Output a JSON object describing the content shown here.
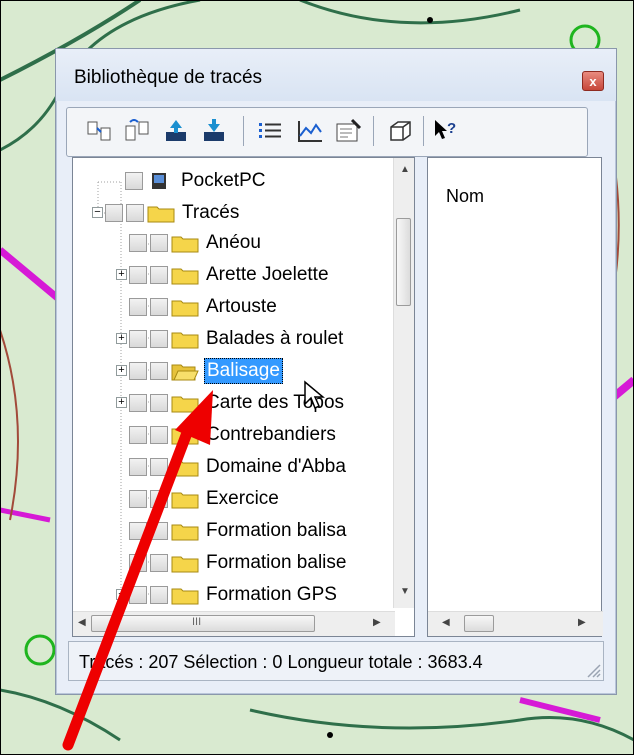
{
  "window": {
    "title": "Bibliothèque de tracés",
    "close_glyph": "x"
  },
  "toolbar": {
    "buttons": [
      {
        "icon": "move-items-icon"
      },
      {
        "icon": "transfer-items-icon"
      },
      {
        "icon": "gps-upload-icon"
      },
      {
        "icon": "gps-download-icon"
      },
      {
        "icon": "list-view-icon"
      },
      {
        "icon": "profile-chart-icon"
      },
      {
        "icon": "properties-icon"
      },
      {
        "icon": "3d-view-icon"
      },
      {
        "icon": "help-cursor-icon"
      }
    ]
  },
  "tree": {
    "nodes": [
      {
        "label": "PocketPC",
        "type": "device"
      },
      {
        "label": "Tracés",
        "type": "folder",
        "expanded": true
      },
      {
        "label": "Anéou",
        "type": "folder"
      },
      {
        "label": "Arette Joelette",
        "type": "folder",
        "expandable": true
      },
      {
        "label": "Artouste",
        "type": "folder"
      },
      {
        "label": "Balades à roulet",
        "type": "folder",
        "expandable": true
      },
      {
        "label": "Balisage",
        "type": "folder",
        "expandable": true,
        "selected": true
      },
      {
        "label": "Carte des Topos",
        "type": "folder",
        "expandable": true
      },
      {
        "label": "Contrebandiers",
        "type": "folder"
      },
      {
        "label": "Domaine d'Abba",
        "type": "folder"
      },
      {
        "label": "Exercice",
        "type": "folder"
      },
      {
        "label": "Formation balisa",
        "type": "folder"
      },
      {
        "label": "Formation balise",
        "type": "folder"
      },
      {
        "label": "Formation GPS",
        "type": "folder",
        "expandable": true
      }
    ],
    "scroll_glyph": "III"
  },
  "list": {
    "column_header": "Nom"
  },
  "status": {
    "text": "Tracés : 207 Sélection : 0 Longueur totale : 3683.4"
  },
  "colors": {
    "selection": "#3399ff",
    "folder": "#f5d54a",
    "annotation_arrow": "#ee0000"
  }
}
